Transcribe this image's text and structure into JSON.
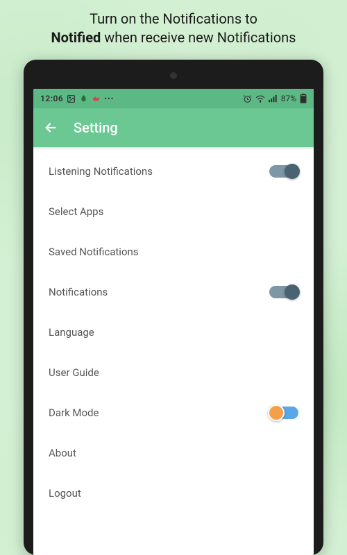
{
  "promo": {
    "line1_a": "Turn on the Notifications  to",
    "line2_bold": "Notified",
    "line2_b": " when receive new Notifications"
  },
  "statusbar": {
    "time": "12:06",
    "battery": "87%"
  },
  "appbar": {
    "title": "Setting"
  },
  "settings": [
    {
      "label": "Listening Notifications",
      "toggle": true,
      "state": "dark"
    },
    {
      "label": "Select Apps",
      "toggle": false
    },
    {
      "label": "Saved Notifications",
      "toggle": false
    },
    {
      "label": "Notifications",
      "toggle": true,
      "state": "dark"
    },
    {
      "label": "Language",
      "toggle": false
    },
    {
      "label": "User Guide",
      "toggle": false
    },
    {
      "label": "Dark Mode",
      "toggle": true,
      "state": "orange"
    },
    {
      "label": "About",
      "toggle": false
    },
    {
      "label": "Logout",
      "toggle": false
    }
  ]
}
